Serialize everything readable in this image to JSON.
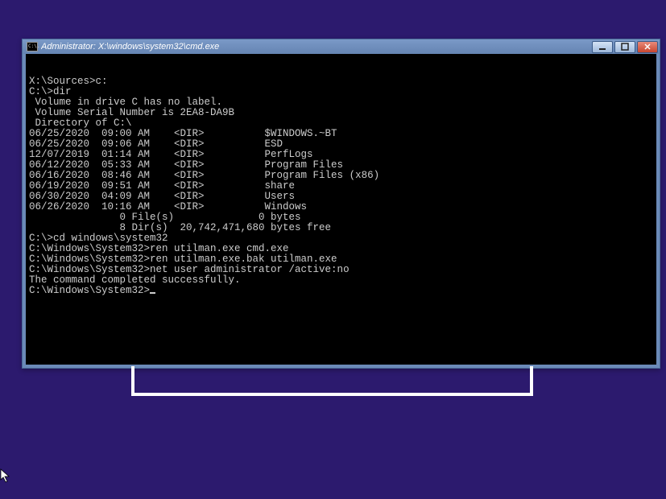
{
  "window": {
    "title_prefix": "C:\\.",
    "title": "Administrator: X:\\windows\\system32\\cmd.exe"
  },
  "terminal": {
    "lines": [
      "X:\\Sources>c:",
      "",
      "C:\\>dir",
      " Volume in drive C has no label.",
      " Volume Serial Number is 2EA8-DA9B",
      "",
      " Directory of C:\\",
      "",
      "06/25/2020  09:00 AM    <DIR>          $WINDOWS.~BT",
      "06/25/2020  09:06 AM    <DIR>          ESD",
      "12/07/2019  01:14 AM    <DIR>          PerfLogs",
      "06/12/2020  05:33 AM    <DIR>          Program Files",
      "06/16/2020  08:46 AM    <DIR>          Program Files (x86)",
      "06/19/2020  09:51 AM    <DIR>          share",
      "06/30/2020  04:09 AM    <DIR>          Users",
      "06/26/2020  10:16 AM    <DIR>          Windows",
      "               0 File(s)              0 bytes",
      "               8 Dir(s)  20,742,471,680 bytes free",
      "",
      "C:\\>cd windows\\system32",
      "",
      "C:\\Windows\\System32>ren utilman.exe cmd.exe",
      "",
      "C:\\Windows\\System32>ren utilman.exe.bak utilman.exe",
      "",
      "C:\\Windows\\System32>net user administrator /active:no",
      "The command completed successfully.",
      ""
    ],
    "prompt": "C:\\Windows\\System32>"
  }
}
